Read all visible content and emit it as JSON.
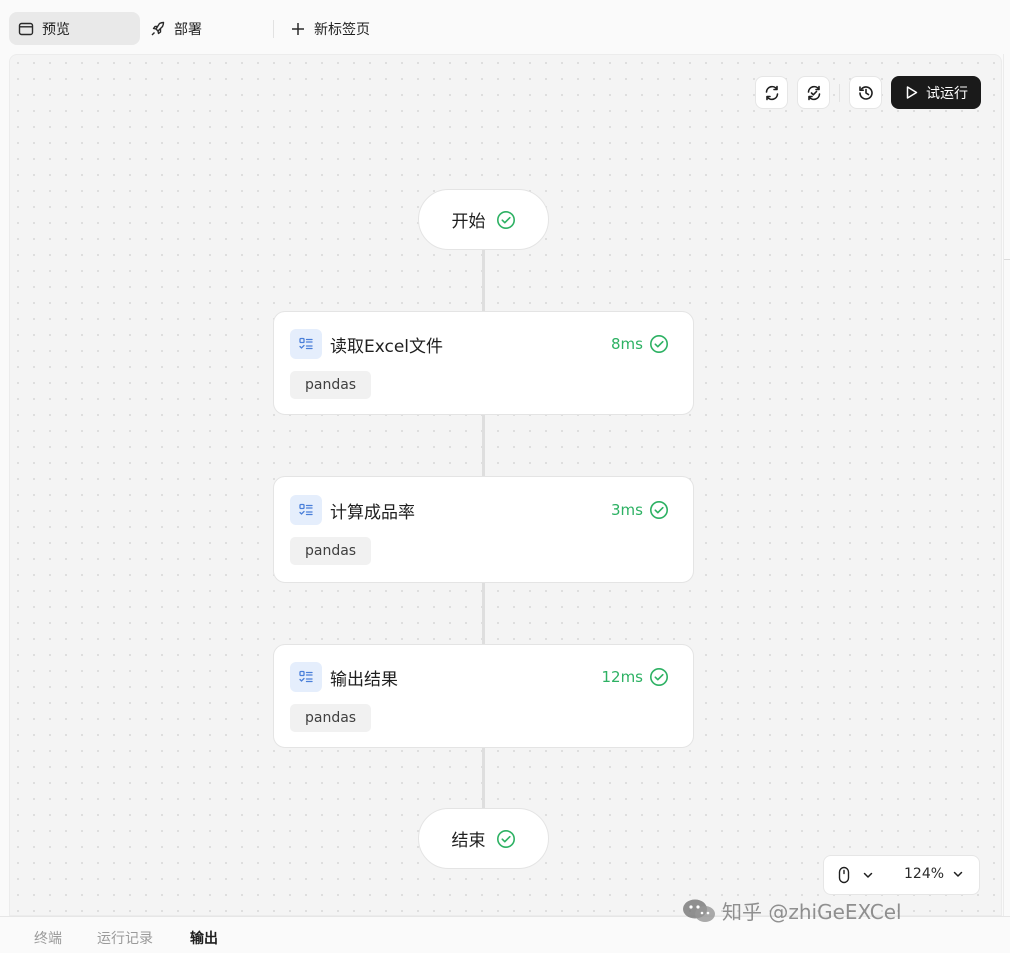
{
  "tabs": [
    {
      "label": "预览",
      "icon": "browser-window-icon",
      "active": true
    },
    {
      "label": "部署",
      "icon": "rocket-icon",
      "active": false
    },
    {
      "label": "新标签页",
      "icon": "plus-icon",
      "active": false
    }
  ],
  "toolbar": {
    "run_label": "试运行",
    "refresh_icon": "refresh-icon",
    "sync_icon": "sync-icon",
    "history_icon": "history-icon",
    "play_icon": "play-icon"
  },
  "flow": {
    "start_label": "开始",
    "end_label": "结束",
    "nodes": [
      {
        "title": "读取Excel文件",
        "time": "8ms",
        "tag": "pandas"
      },
      {
        "title": "计算成品率",
        "time": "3ms",
        "tag": "pandas"
      },
      {
        "title": "输出结果",
        "time": "12ms",
        "tag": "pandas"
      }
    ],
    "status_color": "#2db163"
  },
  "zoom": {
    "value": "124%",
    "mode_icon": "mouse-icon"
  },
  "bottom_tabs": [
    {
      "label": "终端",
      "active": false
    },
    {
      "label": "运行记录",
      "active": false
    },
    {
      "label": "输出",
      "active": true
    }
  ],
  "watermark": {
    "text": "知乎 @zhiGeEXCel"
  }
}
